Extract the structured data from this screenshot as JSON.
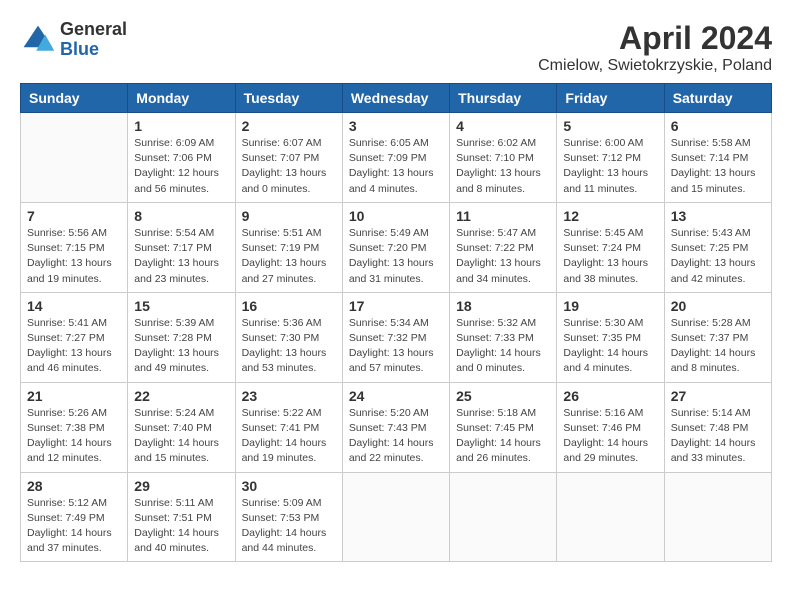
{
  "logo": {
    "general": "General",
    "blue": "Blue"
  },
  "title": "April 2024",
  "location": "Cmielow, Swietokrzyskie, Poland",
  "weekdays": [
    "Sunday",
    "Monday",
    "Tuesday",
    "Wednesday",
    "Thursday",
    "Friday",
    "Saturday"
  ],
  "weeks": [
    [
      {
        "num": "",
        "info": ""
      },
      {
        "num": "1",
        "info": "Sunrise: 6:09 AM\nSunset: 7:06 PM\nDaylight: 12 hours\nand 56 minutes."
      },
      {
        "num": "2",
        "info": "Sunrise: 6:07 AM\nSunset: 7:07 PM\nDaylight: 13 hours\nand 0 minutes."
      },
      {
        "num": "3",
        "info": "Sunrise: 6:05 AM\nSunset: 7:09 PM\nDaylight: 13 hours\nand 4 minutes."
      },
      {
        "num": "4",
        "info": "Sunrise: 6:02 AM\nSunset: 7:10 PM\nDaylight: 13 hours\nand 8 minutes."
      },
      {
        "num": "5",
        "info": "Sunrise: 6:00 AM\nSunset: 7:12 PM\nDaylight: 13 hours\nand 11 minutes."
      },
      {
        "num": "6",
        "info": "Sunrise: 5:58 AM\nSunset: 7:14 PM\nDaylight: 13 hours\nand 15 minutes."
      }
    ],
    [
      {
        "num": "7",
        "info": "Sunrise: 5:56 AM\nSunset: 7:15 PM\nDaylight: 13 hours\nand 19 minutes."
      },
      {
        "num": "8",
        "info": "Sunrise: 5:54 AM\nSunset: 7:17 PM\nDaylight: 13 hours\nand 23 minutes."
      },
      {
        "num": "9",
        "info": "Sunrise: 5:51 AM\nSunset: 7:19 PM\nDaylight: 13 hours\nand 27 minutes."
      },
      {
        "num": "10",
        "info": "Sunrise: 5:49 AM\nSunset: 7:20 PM\nDaylight: 13 hours\nand 31 minutes."
      },
      {
        "num": "11",
        "info": "Sunrise: 5:47 AM\nSunset: 7:22 PM\nDaylight: 13 hours\nand 34 minutes."
      },
      {
        "num": "12",
        "info": "Sunrise: 5:45 AM\nSunset: 7:24 PM\nDaylight: 13 hours\nand 38 minutes."
      },
      {
        "num": "13",
        "info": "Sunrise: 5:43 AM\nSunset: 7:25 PM\nDaylight: 13 hours\nand 42 minutes."
      }
    ],
    [
      {
        "num": "14",
        "info": "Sunrise: 5:41 AM\nSunset: 7:27 PM\nDaylight: 13 hours\nand 46 minutes."
      },
      {
        "num": "15",
        "info": "Sunrise: 5:39 AM\nSunset: 7:28 PM\nDaylight: 13 hours\nand 49 minutes."
      },
      {
        "num": "16",
        "info": "Sunrise: 5:36 AM\nSunset: 7:30 PM\nDaylight: 13 hours\nand 53 minutes."
      },
      {
        "num": "17",
        "info": "Sunrise: 5:34 AM\nSunset: 7:32 PM\nDaylight: 13 hours\nand 57 minutes."
      },
      {
        "num": "18",
        "info": "Sunrise: 5:32 AM\nSunset: 7:33 PM\nDaylight: 14 hours\nand 0 minutes."
      },
      {
        "num": "19",
        "info": "Sunrise: 5:30 AM\nSunset: 7:35 PM\nDaylight: 14 hours\nand 4 minutes."
      },
      {
        "num": "20",
        "info": "Sunrise: 5:28 AM\nSunset: 7:37 PM\nDaylight: 14 hours\nand 8 minutes."
      }
    ],
    [
      {
        "num": "21",
        "info": "Sunrise: 5:26 AM\nSunset: 7:38 PM\nDaylight: 14 hours\nand 12 minutes."
      },
      {
        "num": "22",
        "info": "Sunrise: 5:24 AM\nSunset: 7:40 PM\nDaylight: 14 hours\nand 15 minutes."
      },
      {
        "num": "23",
        "info": "Sunrise: 5:22 AM\nSunset: 7:41 PM\nDaylight: 14 hours\nand 19 minutes."
      },
      {
        "num": "24",
        "info": "Sunrise: 5:20 AM\nSunset: 7:43 PM\nDaylight: 14 hours\nand 22 minutes."
      },
      {
        "num": "25",
        "info": "Sunrise: 5:18 AM\nSunset: 7:45 PM\nDaylight: 14 hours\nand 26 minutes."
      },
      {
        "num": "26",
        "info": "Sunrise: 5:16 AM\nSunset: 7:46 PM\nDaylight: 14 hours\nand 29 minutes."
      },
      {
        "num": "27",
        "info": "Sunrise: 5:14 AM\nSunset: 7:48 PM\nDaylight: 14 hours\nand 33 minutes."
      }
    ],
    [
      {
        "num": "28",
        "info": "Sunrise: 5:12 AM\nSunset: 7:49 PM\nDaylight: 14 hours\nand 37 minutes."
      },
      {
        "num": "29",
        "info": "Sunrise: 5:11 AM\nSunset: 7:51 PM\nDaylight: 14 hours\nand 40 minutes."
      },
      {
        "num": "30",
        "info": "Sunrise: 5:09 AM\nSunset: 7:53 PM\nDaylight: 14 hours\nand 44 minutes."
      },
      {
        "num": "",
        "info": ""
      },
      {
        "num": "",
        "info": ""
      },
      {
        "num": "",
        "info": ""
      },
      {
        "num": "",
        "info": ""
      }
    ]
  ]
}
